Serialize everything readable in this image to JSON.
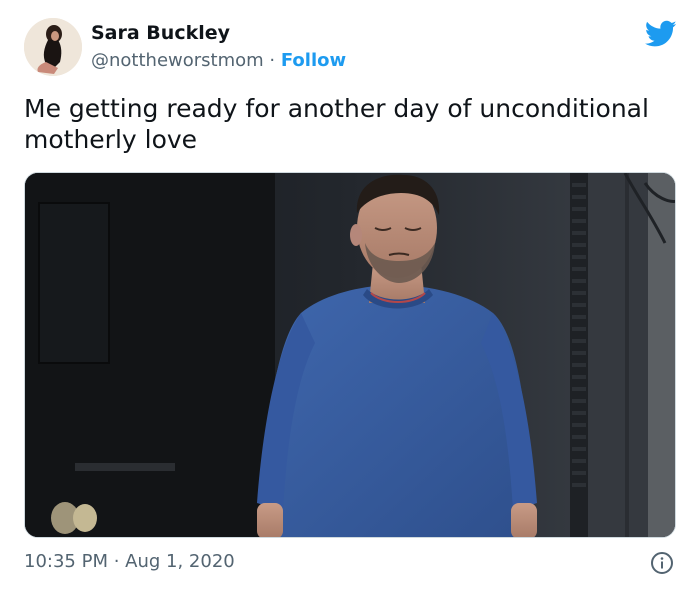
{
  "author": {
    "name": "Sara Buckley",
    "handle": "@nottheworstmom",
    "separator": " · ",
    "follow_label": "Follow"
  },
  "tweet": {
    "text": "Me getting ready for another day of unconditional motherly love",
    "time": "10:35 PM",
    "separator": " · ",
    "date": "Aug 1, 2020"
  },
  "icons": {
    "brand": "twitter-bird-icon",
    "info": "info-icon"
  },
  "colors": {
    "accent": "#1d9bf0",
    "secondary_text": "#536471",
    "primary_text": "#0f1419",
    "sweater_blue": "#3a5fa0"
  }
}
